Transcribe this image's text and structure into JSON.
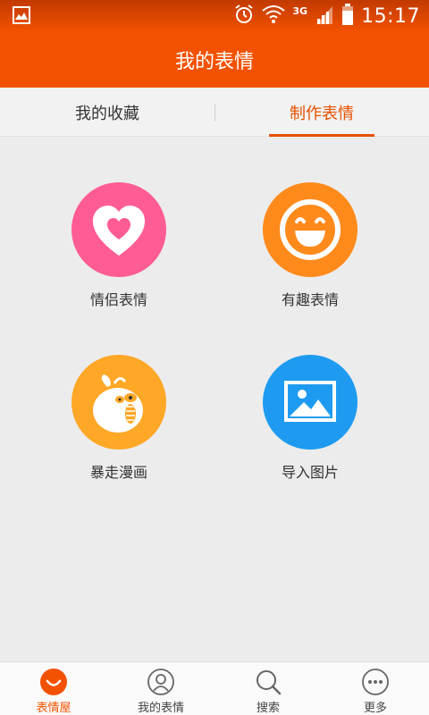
{
  "status_bar": {
    "network": "3G",
    "time": "15:17"
  },
  "header": {
    "title": "我的表情"
  },
  "tabs": [
    {
      "label": "我的收藏",
      "selected": false
    },
    {
      "label": "制作表情",
      "selected": true
    }
  ],
  "grid": [
    {
      "label": "情侣表情",
      "icon": "heart-icon",
      "color": "#ff5c95"
    },
    {
      "label": "有趣表情",
      "icon": "laughing-face-icon",
      "color": "#ff8a1c"
    },
    {
      "label": "暴走漫画",
      "icon": "rage-comic-face-icon",
      "color": "#ffa726"
    },
    {
      "label": "导入图片",
      "icon": "image-icon",
      "color": "#1e9bf0"
    }
  ],
  "bottom_nav": [
    {
      "label": "表情屋",
      "icon": "smile-icon",
      "active": true
    },
    {
      "label": "我的表情",
      "icon": "user-icon",
      "active": false
    },
    {
      "label": "搜索",
      "icon": "search-icon",
      "active": false
    },
    {
      "label": "更多",
      "icon": "more-icon",
      "active": false
    }
  ],
  "colors": {
    "accent": "#f25200",
    "tab_active": "#e65100",
    "background": "#ececec"
  }
}
